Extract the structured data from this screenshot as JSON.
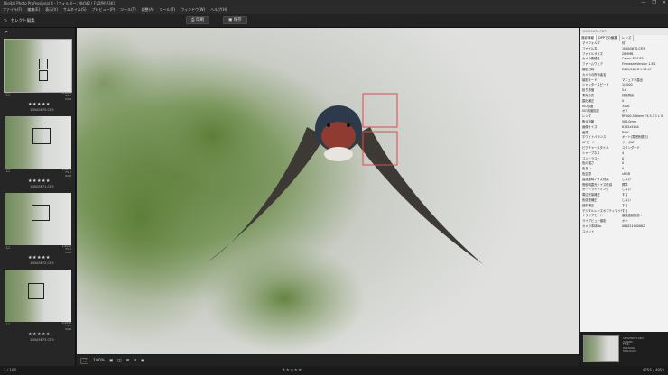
{
  "window": {
    "title": "Digital Photo Professional 4 - [フォルダー: Nkfjd2 | F:\\DPA\\P3K]",
    "controls": [
      "—",
      "❐",
      "✕"
    ]
  },
  "menu": [
    "ファイル(F)",
    "編集(E)",
    "表示(V)",
    "サムネイル(S)",
    "プレビュー(P)",
    "ツール(T)",
    "調整(A)",
    "ツール(T)",
    "ウィンドウ(W)",
    "ヘルプ(H)"
  ],
  "toolbar": {
    "view_label": "セレクト編集",
    "print_label": "印刷",
    "save_label": "保存"
  },
  "thumbnails": [
    {
      "stars": "★★★★★",
      "filename": "1N5A5670.CR3",
      "meta": [
        "1/4000",
        "F5.6",
        "ISO8"
      ]
    },
    {
      "stars": "★★★★★",
      "filename": "1N5A5671.CR3",
      "meta": [
        "1/4000",
        "F5.6",
        "ISO8"
      ]
    },
    {
      "stars": "★★★★★",
      "filename": "1N5A5672.CR3",
      "meta": [
        "1/4000",
        "F5.6",
        "ISO8"
      ]
    },
    {
      "stars": "★★★★★",
      "filename": "1N5A5673.CR3",
      "meta": [
        "1/4000",
        "F5.6",
        "ISO8"
      ]
    }
  ],
  "info_panel": {
    "title": "1N5A5670.CR3",
    "tabs": [
      "撮影情報",
      "DPPでの編集",
      "レンズ"
    ],
    "rows": [
      [
        "マイフォルダ",
        "情"
      ],
      [
        "ファイル名",
        "1N5A5670.CR3"
      ],
      [
        "ファイルサイズ",
        "28.9MB"
      ],
      [
        "カメラ機種名",
        "Canon EOS R5"
      ],
      [
        "ファームウェア",
        "Firmware Version 1.8.1"
      ],
      [
        "撮影日時",
        "2022/06/28 9:58:47"
      ],
      [
        "カメラの所有者名",
        ""
      ],
      [
        "撮影モード",
        "マニュアル露出"
      ],
      [
        "シャッタースピード",
        "1/4000"
      ],
      [
        "絞り数値",
        "5.6"
      ],
      [
        "測光方式",
        "評価測光"
      ],
      [
        "露出補正",
        "0"
      ],
      [
        "ISO感度",
        "3200"
      ],
      [
        "ISO感度拡張",
        "オフ"
      ],
      [
        "レンズ",
        "RF100-500mm F4.5-7.1 L IS"
      ],
      [
        "焦点距離",
        "500.0mm"
      ],
      [
        "画像サイズ",
        "8192x5464"
      ],
      [
        "画質",
        "RAW"
      ],
      [
        "ホワイトバランス",
        "オート(雰囲気優先)"
      ],
      [
        "AFモード",
        "サーボAF"
      ],
      [
        "ピクチャースタイル",
        "スタンダード"
      ],
      [
        "シャープネス",
        "4"
      ],
      [
        "コントラスト",
        "0"
      ],
      [
        "色の濃さ",
        "0"
      ],
      [
        "色あい",
        "0"
      ],
      [
        "色空間",
        "sRGB"
      ],
      [
        "高感度時ノイズ低減",
        "しない"
      ],
      [
        "長秒時露光ノイズ低減",
        "標準"
      ],
      [
        "オートライティング",
        "しない"
      ],
      [
        "周辺光量補正",
        "する"
      ],
      [
        "色収差補正",
        "しない"
      ],
      [
        "回折補正",
        "する"
      ],
      [
        "デジタルレンズオプティマイザ",
        "する"
      ],
      [
        "ドライブモード",
        "高速連続撮影+"
      ],
      [
        "ライブビュー撮影",
        "オン"
      ],
      [
        "カメラ本体No.",
        "081021000062"
      ],
      [
        "コメント",
        ""
      ]
    ]
  },
  "navigator": {
    "meta": [
      "1N5A5670.CR3",
      "1/4000",
      "F5.6",
      "ISO3200",
      "500.0mm"
    ]
  },
  "center_toolbar": {
    "zoom": "100%",
    "items": [
      "⛶",
      "▣",
      "◫",
      "⊞",
      "⌗",
      "◉"
    ]
  },
  "status": {
    "left": "1 / 180",
    "right": "4756 / 4850",
    "rating_stars": "★★★★★"
  }
}
